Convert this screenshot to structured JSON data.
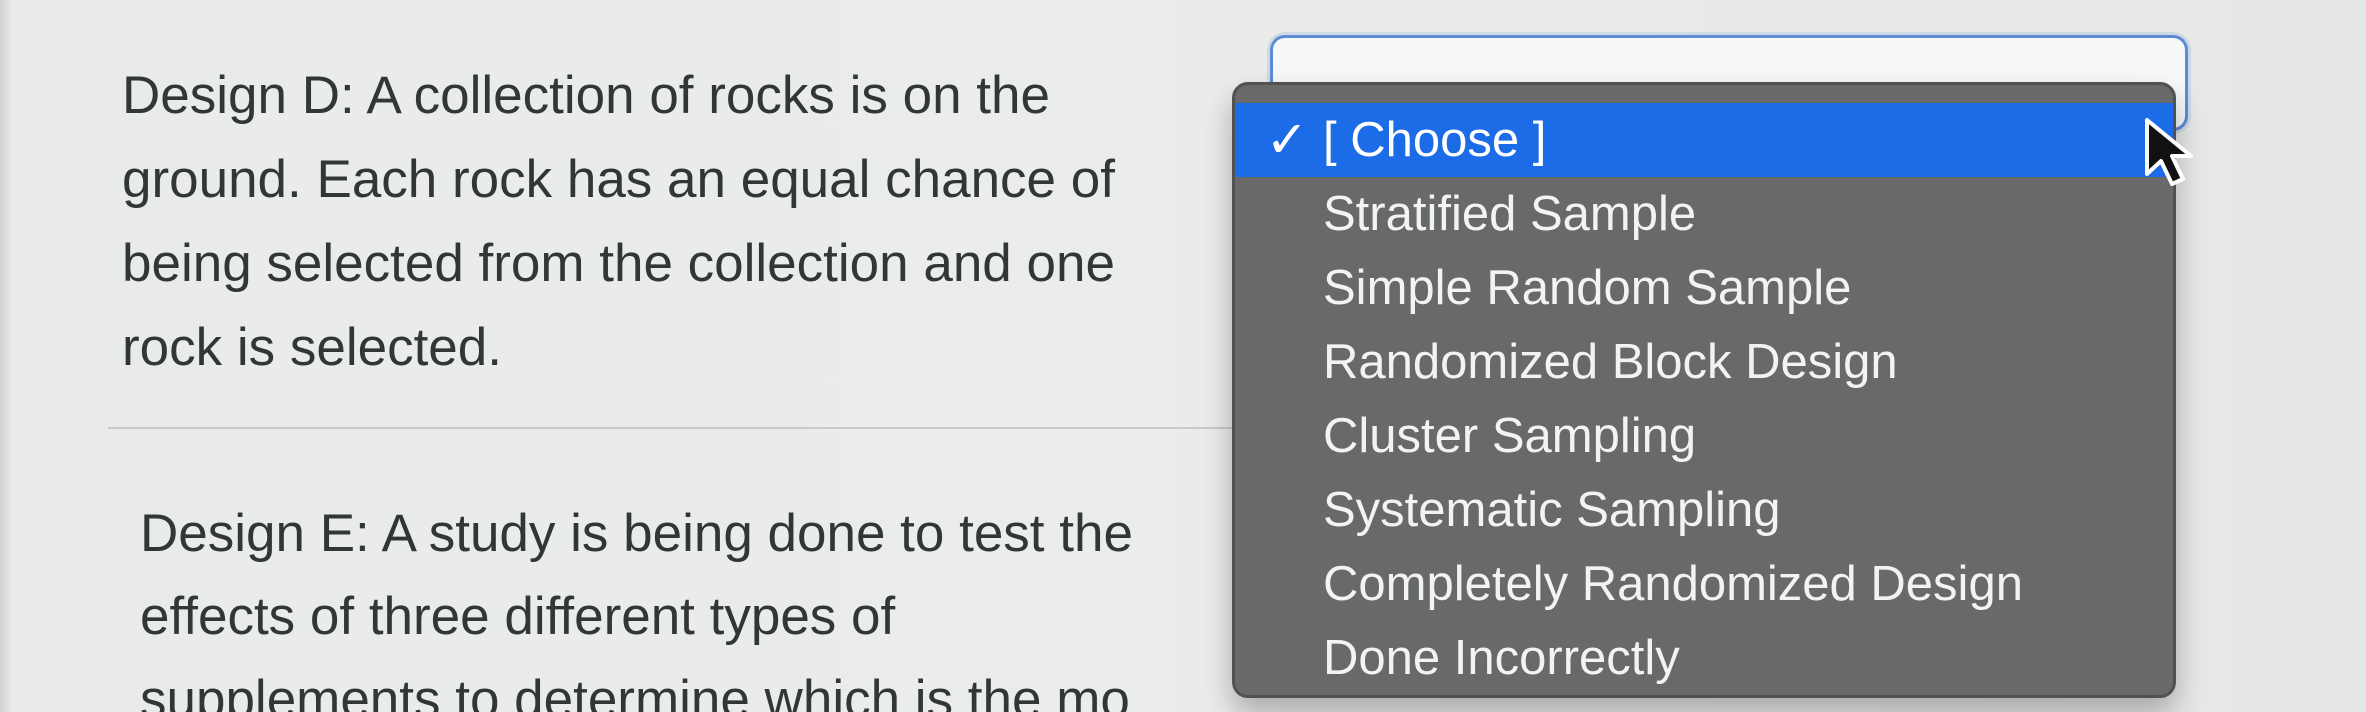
{
  "question": {
    "design_d_lines": [
      "Design D: A collection of rocks is on the",
      "ground. Each rock has an equal chance of",
      "being selected from the collection and one",
      "rock is selected."
    ],
    "design_e_lines": [
      "Design E: A study is being done to test the",
      "effects of three different types of",
      "supplements to determine which is the mo"
    ]
  },
  "dropdown": {
    "selected_check": "✓",
    "options": [
      "[ Choose ]",
      "Stratified Sample",
      "Simple Random Sample",
      "Randomized Block Design",
      "Cluster Sampling",
      "Systematic Sampling",
      "Completely Randomized Design",
      "Done Incorrectly"
    ]
  },
  "icons": {
    "checkmark": "checkmark-icon",
    "cursor": "mouse-pointer-icon"
  },
  "colors": {
    "selection_blue": "#1c6be7",
    "menu_gray": "#676a69",
    "focus_blue": "#5d8cd6"
  }
}
